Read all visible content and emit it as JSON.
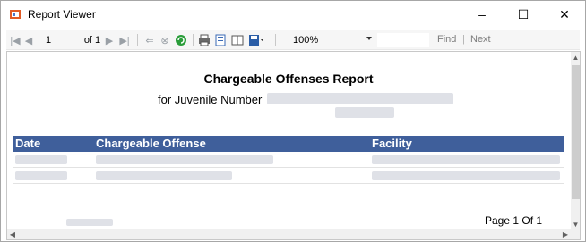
{
  "window": {
    "title": "Report Viewer"
  },
  "controls": {
    "minimize": "–",
    "maximize": "☐",
    "close": "✕"
  },
  "toolbar": {
    "current_page": "1",
    "of_pages": "of 1",
    "zoom": "100%",
    "find_label": "Find",
    "separator": "|",
    "next_label": "Next"
  },
  "report": {
    "title": "Chargeable Offenses Report",
    "subtitle_prefix": "for Juvenile Number",
    "columns": [
      "Date",
      "Chargeable Offense",
      "Facility"
    ],
    "page_label": "Page 1 Of 1"
  },
  "colors": {
    "table_header": "#3f5f9b"
  },
  "icons": [
    "first-page-icon",
    "prev-page-icon",
    "next-page-icon",
    "last-page-icon",
    "back-icon",
    "stop-icon",
    "refresh-icon",
    "print-icon",
    "print-layout-icon",
    "page-setup-icon",
    "export-icon"
  ]
}
